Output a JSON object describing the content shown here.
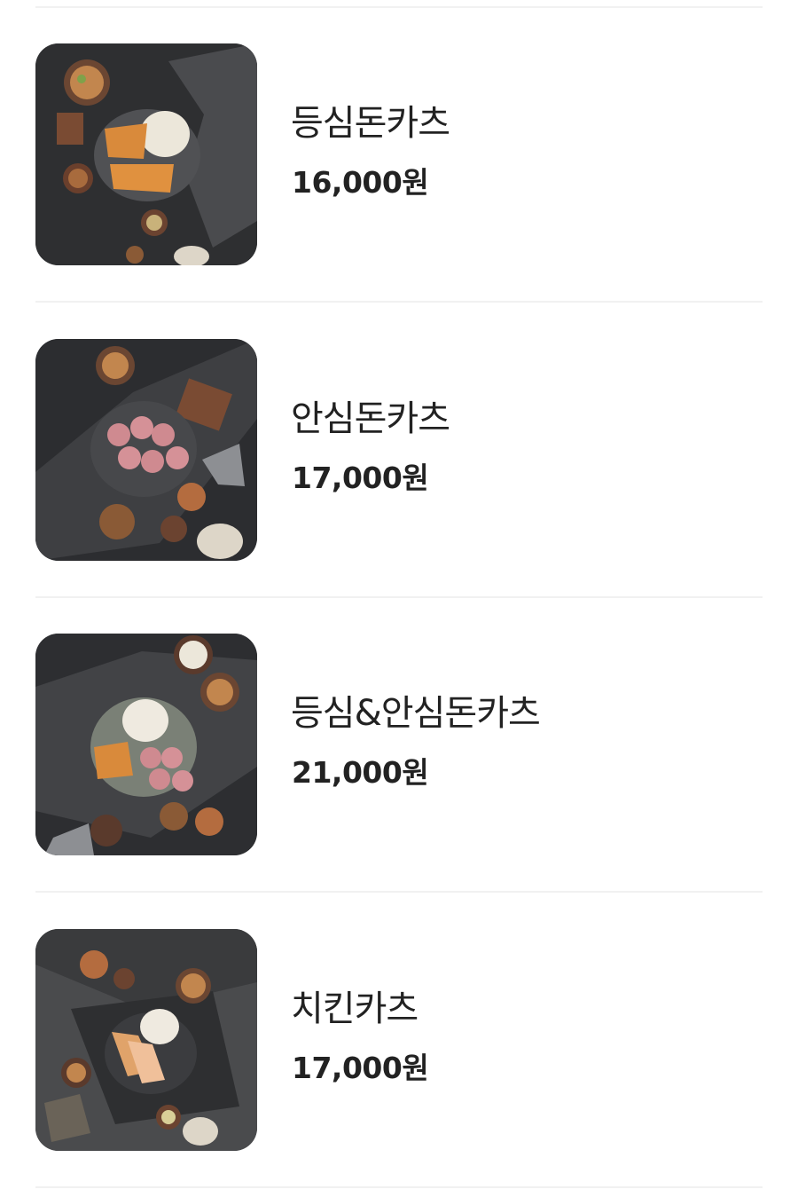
{
  "menu": {
    "items": [
      {
        "name": "등심돈카츠",
        "price": "16,000원",
        "image": "pork-loin-cutlet-photo"
      },
      {
        "name": "안심돈카츠",
        "price": "17,000원",
        "image": "pork-tenderloin-cutlet-photo"
      },
      {
        "name": "등심&안심돈카츠",
        "price": "21,000원",
        "image": "loin-and-tenderloin-cutlet-photo"
      },
      {
        "name": "치킨카츠",
        "price": "17,000원",
        "image": "chicken-cutlet-photo"
      }
    ]
  },
  "colors": {
    "text": "#222222",
    "divider": "#f1f1f1",
    "photo_background": "#2f3032"
  }
}
